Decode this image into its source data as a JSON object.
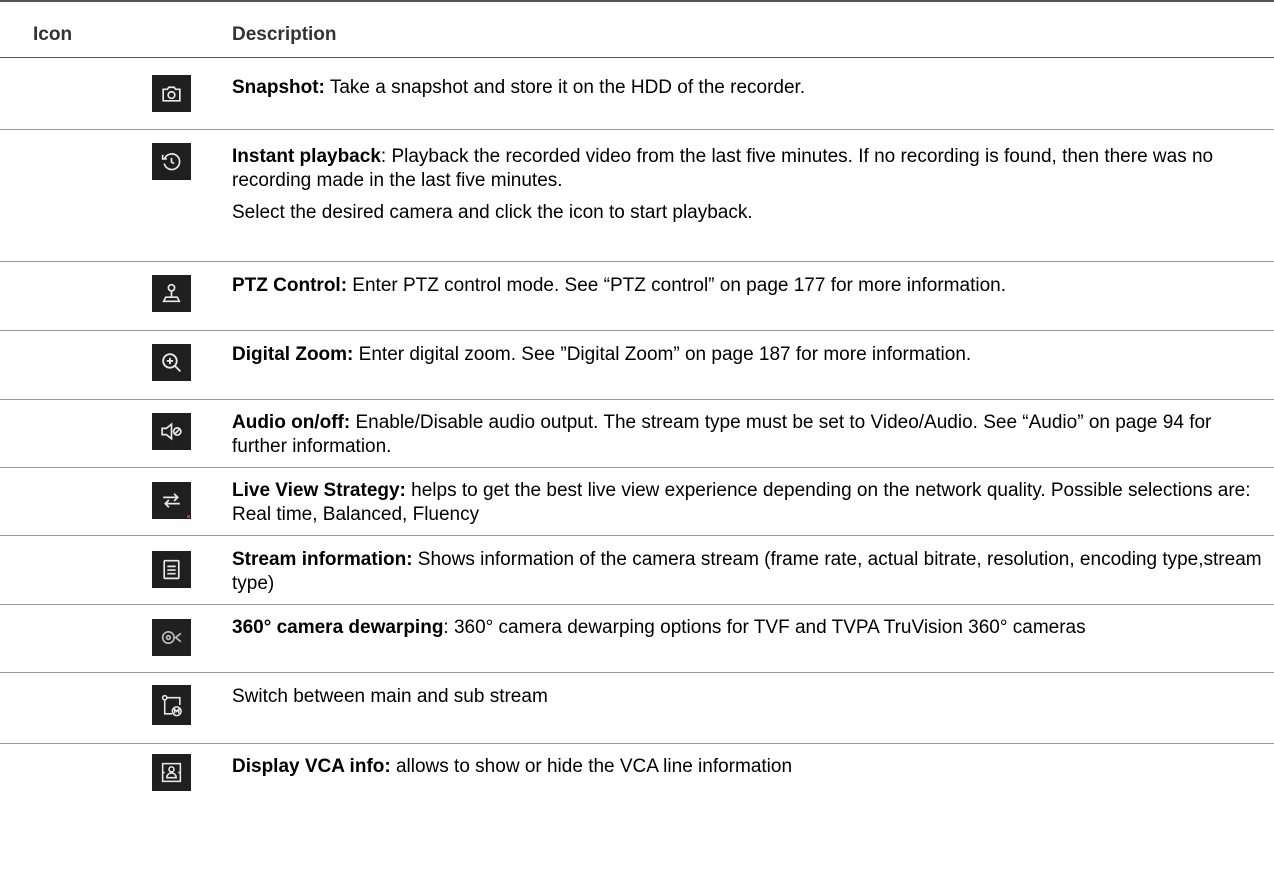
{
  "header": {
    "icon_col": "Icon",
    "desc_col": "Description"
  },
  "rows": [
    {
      "icon": "camera-icon",
      "term": "Snapshot:",
      "text": " Take a snapshot and store it on the HDD of the recorder."
    },
    {
      "icon": "history-clock-icon",
      "term": "Instant playback",
      "text": ": Playback the recorded video from the last five minutes. If no recording is found, then there was no recording made in the last five minutes.",
      "extra": "Select the desired camera and click the icon to start playback."
    },
    {
      "icon": "ptz-joystick-icon",
      "term": "PTZ Control:",
      "text": " Enter PTZ control mode. See “PTZ control” on page 177 for more information."
    },
    {
      "icon": "zoom-in-icon",
      "term": "Digital Zoom:",
      "text": " Enter digital zoom. See ”Digital Zoom” on page 187  for more information."
    },
    {
      "icon": "speaker-mute-icon",
      "term": "Audio on/off:",
      "text": " Enable/Disable audio output. The stream type must be set to Video/Audio. See  “Audio” on page 94 for further information."
    },
    {
      "icon": "swap-arrows-icon",
      "term": "Live View Strategy:",
      "text": " helps to get the best live view experience depending on the network quality. Possible selections are: Real time, Balanced, Fluency"
    },
    {
      "icon": "document-list-icon",
      "term": "Stream information:",
      "text": " Shows information of the camera stream (frame rate, actual bitrate, resolution, encoding type,stream type)"
    },
    {
      "icon": "fisheye-camera-icon",
      "term": "360° camera dewarping",
      "text": ": 360° camera dewarping options for TVF and TVPA TruVision 360° cameras"
    },
    {
      "icon": "main-sub-stream-icon",
      "term": "",
      "text": "Switch between main and sub stream"
    },
    {
      "icon": "vca-person-icon",
      "term": "Display VCA info:",
      "text": " allows to show or hide the VCA line information"
    }
  ]
}
